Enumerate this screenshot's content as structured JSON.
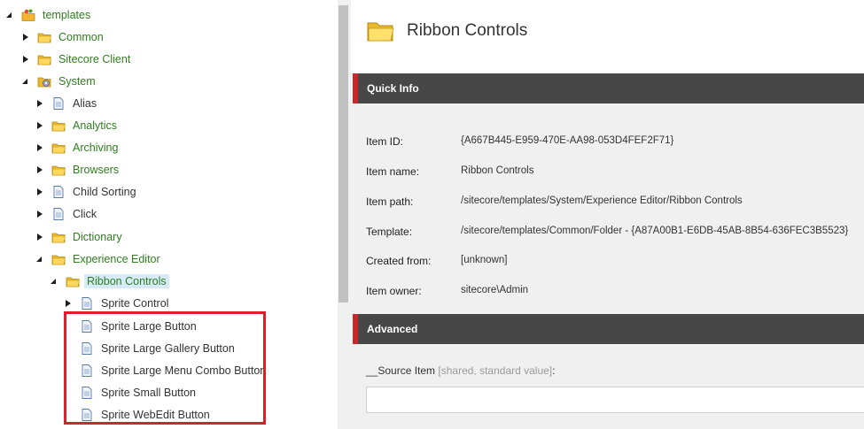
{
  "tree": {
    "root": "templates",
    "nodes": [
      {
        "label": "Common"
      },
      {
        "label": "Sitecore Client"
      },
      {
        "label": "System"
      },
      {
        "label": "Alias"
      },
      {
        "label": "Analytics"
      },
      {
        "label": "Archiving"
      },
      {
        "label": "Browsers"
      },
      {
        "label": "Child Sorting"
      },
      {
        "label": "Click"
      },
      {
        "label": "Dictionary"
      },
      {
        "label": "Experience Editor"
      },
      {
        "label": "Ribbon Controls"
      },
      {
        "label": "Sprite Control"
      },
      {
        "label": "Sprite Large Button"
      },
      {
        "label": "Sprite Large Gallery Button"
      },
      {
        "label": "Sprite Large Menu Combo Button"
      },
      {
        "label": "Sprite Small Button"
      },
      {
        "label": "Sprite WebEdit Button"
      }
    ]
  },
  "content": {
    "title": "Ribbon Controls",
    "quick_info": {
      "section_title": "Quick Info",
      "fields": [
        {
          "label": "Item ID:",
          "value": "{A667B445-E959-470E-AA98-053D4FEF2F71}"
        },
        {
          "label": "Item name:",
          "value": "Ribbon Controls"
        },
        {
          "label": "Item path:",
          "value": "/sitecore/templates/System/Experience Editor/Ribbon Controls"
        },
        {
          "label": "Template:",
          "value": "/sitecore/templates/Common/Folder - {A87A00B1-E6DB-45AB-8B54-636FEC3B5523}"
        },
        {
          "label": "Created from:",
          "value": "[unknown]"
        },
        {
          "label": "Item owner:",
          "value": "sitecore\\Admin"
        }
      ]
    },
    "advanced": {
      "section_title": "Advanced",
      "source_label": "__Source Item",
      "source_hint": "[shared, standard value]",
      "source_colon": ":",
      "source_value": ""
    }
  },
  "colors": {
    "tree_text": "#2f7d1f",
    "selected_bg": "#d6ebf7",
    "highlight_border": "#d8222a",
    "section_bar": "#474747",
    "section_accent": "#c9272c"
  }
}
